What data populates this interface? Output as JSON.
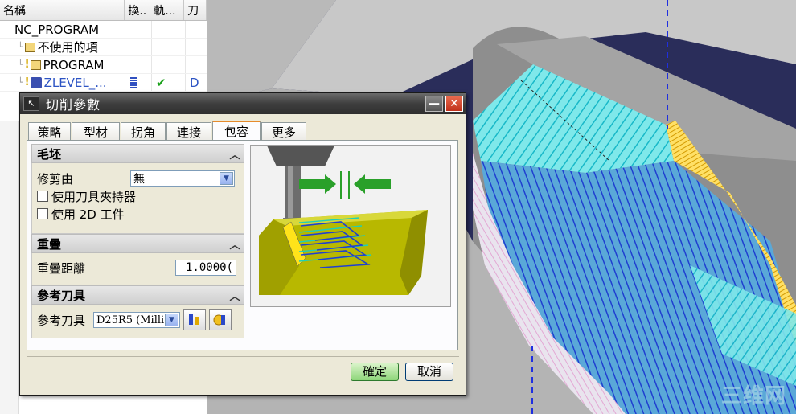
{
  "navigator": {
    "columns": [
      "名稱",
      "換..",
      "軌...",
      "刀"
    ],
    "rows": [
      {
        "name": "NC_PROGRAM",
        "indent": 0
      },
      {
        "name": "不使用的項",
        "indent": 1
      },
      {
        "name": "PROGRAM",
        "indent": 1
      },
      {
        "name": "ZLEVEL_...",
        "indent": 1,
        "status": "✔",
        "tool": "D"
      }
    ]
  },
  "dialog": {
    "title": "切削參數",
    "tabs": [
      "策略",
      "型材",
      "拐角",
      "連接",
      "包容",
      "更多"
    ],
    "active_tab": "包容",
    "groups": {
      "blank": {
        "title": "毛坯",
        "trim_by_label": "修剪由",
        "trim_by_value": "無",
        "use_holder_label": "使用刀具夾持器",
        "use_2d_label": "使用 2D 工件"
      },
      "overlap": {
        "title": "重疊",
        "distance_label": "重疊距離",
        "distance_value": "1.0000("
      },
      "reference_tool": {
        "title": "參考刀具",
        "label": "參考刀具",
        "value": "D25R5 (Milli"
      }
    },
    "ok_label": "確定",
    "cancel_label": "取消"
  },
  "watermark": "三维网",
  "colors": {
    "viewport_bg": "#2a2d5a",
    "toolpath_cyan": "#3fe0e0",
    "toolpath_blue": "#2a48d8",
    "wall_yellow": "#ffd21e",
    "ok_green": "#8ed67a"
  }
}
